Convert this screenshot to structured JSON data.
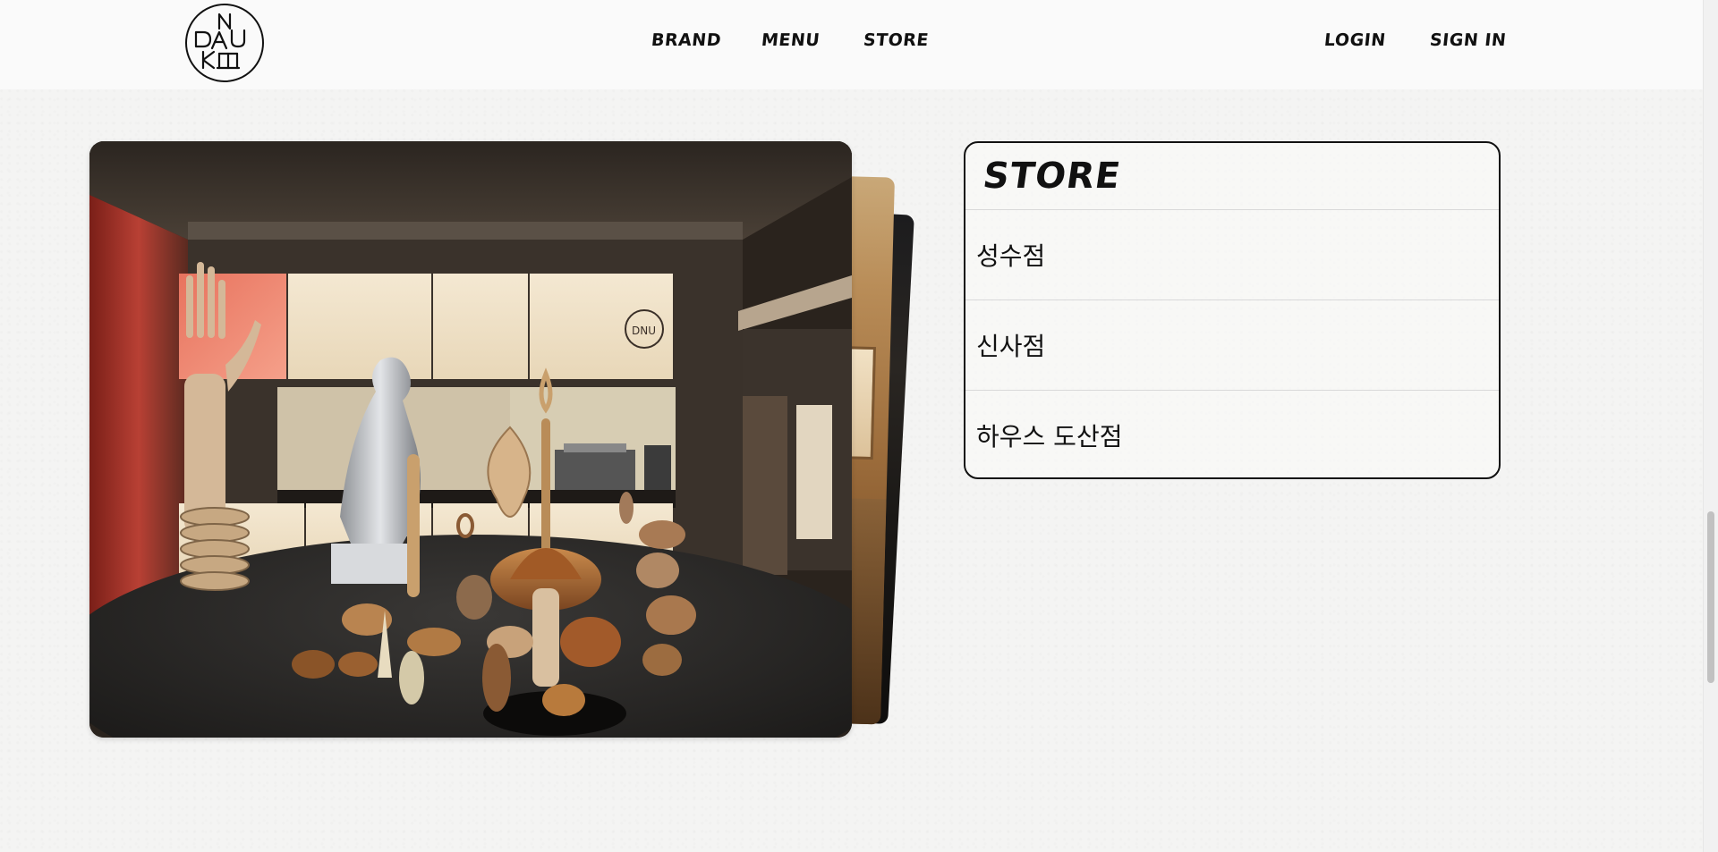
{
  "header": {
    "logo_alt": "DNUKE",
    "nav": {
      "brand": "BRAND",
      "menu": "MENU",
      "store": "STORE",
      "login": "LOGIN",
      "signin": "SIGN IN"
    }
  },
  "gallery": {
    "slides_visible": 3
  },
  "store_panel": {
    "title": "STORE",
    "items": [
      {
        "label": "성수점"
      },
      {
        "label": "신사점"
      },
      {
        "label": "하우스 도산점"
      }
    ]
  },
  "colors": {
    "background": "#f4f4f3",
    "text": "#111111",
    "border": "#111111",
    "divider": "#d9d9d9"
  },
  "icons": {
    "logo": "dnuke-circle-logo"
  }
}
